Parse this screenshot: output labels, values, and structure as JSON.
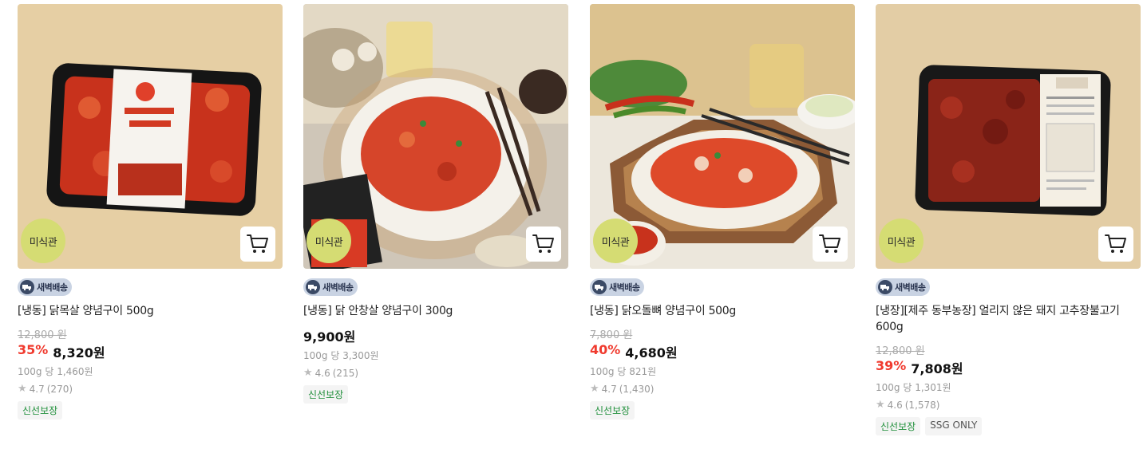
{
  "products": [
    {
      "image_desc": "frozen chicken neck product tray",
      "misik_badge": "미식관",
      "delivery_label": "새벽배송",
      "name": "[냉동] 닭목살 양념구이 500g",
      "original_price": "12,800 원",
      "discount": "35%",
      "price": "8,320원",
      "unit_price": "100g 당 1,460원",
      "rating": "4.7",
      "reviews": "(270)",
      "tags": [
        "신선보장"
      ]
    },
    {
      "image_desc": "stir-fried chicken plate",
      "misik_badge": "미식관",
      "delivery_label": "새벽배송",
      "name": "[냉동] 닭 안창살 양념구이 300g",
      "original_price": "",
      "discount": "",
      "price": "9,900원",
      "unit_price": "100g 당 3,300원",
      "rating": "4.6",
      "reviews": "(215)",
      "tags": [
        "신선보장"
      ]
    },
    {
      "image_desc": "spicy chicken cartilage plate",
      "misik_badge": "미식관",
      "delivery_label": "새벽배송",
      "name": "[냉동] 닭오돌뼈 양념구이 500g",
      "original_price": "7,800 원",
      "discount": "40%",
      "price": "4,680원",
      "unit_price": "100g 당 821원",
      "rating": "4.7",
      "reviews": "(1,430)",
      "tags": [
        "신선보장"
      ]
    },
    {
      "image_desc": "pork bulgogi tray",
      "misik_badge": "미식관",
      "delivery_label": "새벽배송",
      "name": "[냉장][제주 동부농장] 얼리지 않은 돼지 고추장불고기 600g",
      "original_price": "12,800 원",
      "discount": "39%",
      "price": "7,808원",
      "unit_price": "100g 당 1,301원",
      "rating": "4.6",
      "reviews": "(1,578)",
      "tags": [
        "신선보장",
        "SSG ONLY"
      ]
    }
  ],
  "colors": {
    "discount": "#f03a2e",
    "misik_badge_bg": "#d5dc73",
    "tag_green": "#1f8f3a",
    "delivery_bg": "#c9d3e3"
  },
  "icons": {
    "cart": "cart-icon",
    "star": "star-icon",
    "truck": "truck-icon"
  }
}
